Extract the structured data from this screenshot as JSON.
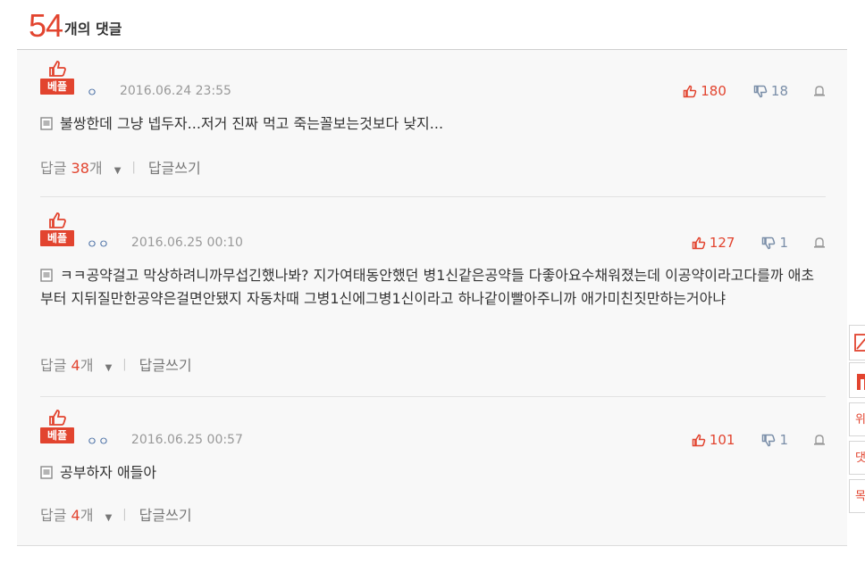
{
  "header": {
    "count": "54",
    "label": "개의 댓글"
  },
  "comments": [
    {
      "badge": "베플",
      "author": "ㅇ",
      "date": "2016.06.24 23:55",
      "likes": "180",
      "dislikes": "18",
      "text": "불쌍한데 그냥 넵두자...저거 진짜 먹고 죽는꼴보는것보다 낮지...",
      "reply_label": "답글",
      "reply_count": "38",
      "reply_unit": "개",
      "write_label": "답글쓰기"
    },
    {
      "badge": "베플",
      "author": "ㅇㅇ",
      "date": "2016.06.25 00:10",
      "likes": "127",
      "dislikes": "1",
      "text": "ㅋㅋ공약걸고 막상하려니까무섭긴했나봐? 지가여태동안했던 병1신같은공약들 다좋아요수채워졌는데 이공약이라고다를까 애초부터 지뒤질만한공약은걸면안됐지 자동차때 그병1신에그병1신이라고 하나같이빨아주니까 애가미친짓만하는거아냐",
      "reply_label": "답글",
      "reply_count": "4",
      "reply_unit": "개",
      "write_label": "답글쓰기"
    },
    {
      "badge": "베플",
      "author": "ㅇㅇ",
      "date": "2016.06.25 00:57",
      "likes": "101",
      "dislikes": "1",
      "text": "공부하자 애들아",
      "reply_label": "답글",
      "reply_count": "4",
      "reply_unit": "개",
      "write_label": "답글쓰기"
    }
  ],
  "side_buttons": [
    {
      "icon": "edit-icon",
      "label": ""
    },
    {
      "icon": "nate-logo-icon",
      "label": ""
    },
    {
      "icon": "",
      "label": "위"
    },
    {
      "icon": "",
      "label": "댓"
    },
    {
      "icon": "",
      "label": "목"
    }
  ],
  "colors": {
    "accent": "#e2442f",
    "dislike": "#7a8ea8",
    "meta": "#999999",
    "panel": "#f8f8f8"
  }
}
